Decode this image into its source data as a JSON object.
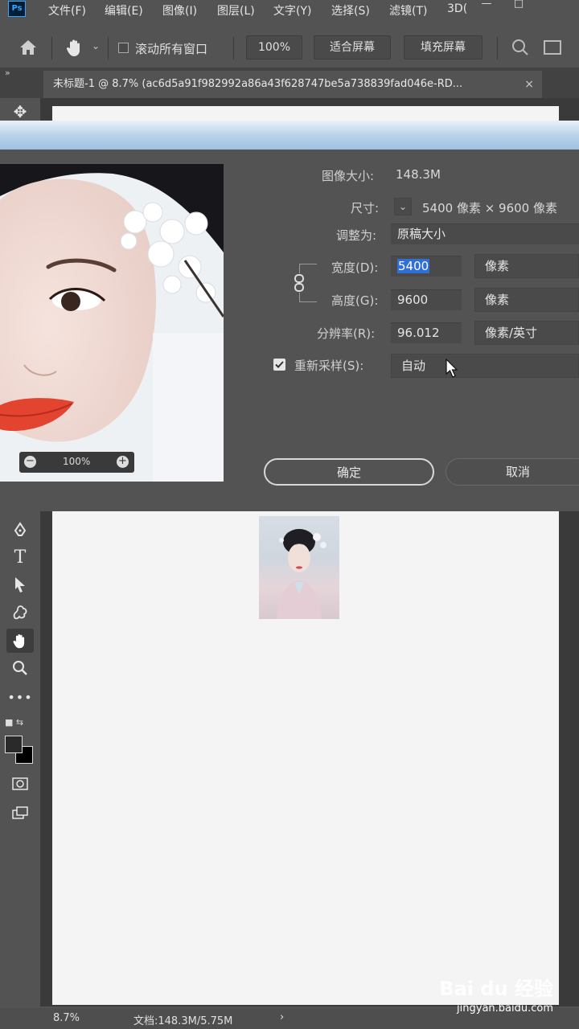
{
  "app": {
    "logo": "Ps"
  },
  "menu": {
    "items": [
      "文件(F)",
      "编辑(E)",
      "图像(I)",
      "图层(L)",
      "文字(Y)",
      "选择(S)",
      "滤镜(T)",
      "3D("
    ],
    "window_controls": [
      "—",
      "□"
    ]
  },
  "options": {
    "home_icon": "home-icon",
    "hand_icon": "hand-icon",
    "scroll_all_label": "滚动所有窗口",
    "zoom_button": "100%",
    "fit_screen": "适合屏幕",
    "fill_screen": "填充屏幕"
  },
  "tab": {
    "title": "未标题-1 @ 8.7% (ac6d5a91f982992a86a43f628747be5a738839fad046e-RD...",
    "close": "×",
    "collapse": "»"
  },
  "dialog": {
    "image_size_label": "图像大小:",
    "image_size_value": "148.3M",
    "dimensions_label": "尺寸:",
    "dimensions_value": "5400 像素 × 9600 像素",
    "fit_to_label": "调整为:",
    "fit_to_value": "原稿大小",
    "width_label": "宽度(D):",
    "width_value": "5400",
    "width_unit": "像素",
    "height_label": "高度(G):",
    "height_value": "9600",
    "height_unit": "像素",
    "resolution_label": "分辨率(R):",
    "resolution_value": "96.012",
    "resolution_unit": "像素/英寸",
    "resample_label": "重新采样(S):",
    "resample_checked": true,
    "resample_value": "自动",
    "ok_label": "确定",
    "cancel_label": "取消",
    "preview_zoom": "100%"
  },
  "status": {
    "zoom": "8.7%",
    "doc": "文档:148.3M/5.75M",
    "arrow": "›"
  },
  "watermark": {
    "brand": "Bai du 经验",
    "url": "jingyan.baidu.com"
  }
}
